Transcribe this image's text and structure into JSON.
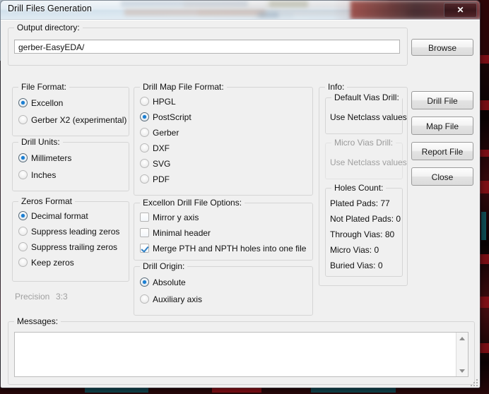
{
  "window": {
    "title": "Drill Files Generation",
    "close_label": "✕"
  },
  "output": {
    "legend": "Output directory:",
    "value": "gerber-EasyEDA/",
    "browse_label": "Browse"
  },
  "file_format": {
    "legend": "File Format:",
    "options": [
      {
        "label": "Excellon",
        "selected": true
      },
      {
        "label": "Gerber X2 (experimental)",
        "selected": false
      }
    ]
  },
  "drill_units": {
    "legend": "Drill Units:",
    "options": [
      {
        "label": "Millimeters",
        "selected": true
      },
      {
        "label": "Inches",
        "selected": false
      }
    ]
  },
  "zeros_format": {
    "legend": "Zeros Format",
    "options": [
      {
        "label": "Decimal format",
        "selected": true
      },
      {
        "label": "Suppress leading zeros",
        "selected": false
      },
      {
        "label": "Suppress trailing zeros",
        "selected": false
      },
      {
        "label": "Keep zeros",
        "selected": false
      }
    ],
    "precision_label": "Precision",
    "precision_value": "3:3"
  },
  "drill_map_format": {
    "legend": "Drill Map File Format:",
    "options": [
      {
        "label": "HPGL",
        "selected": false
      },
      {
        "label": "PostScript",
        "selected": true
      },
      {
        "label": "Gerber",
        "selected": false
      },
      {
        "label": "DXF",
        "selected": false
      },
      {
        "label": "SVG",
        "selected": false
      },
      {
        "label": "PDF",
        "selected": false
      }
    ]
  },
  "excellon_options": {
    "legend": "Excellon Drill File Options:",
    "options": [
      {
        "label": "Mirror y axis",
        "checked": false
      },
      {
        "label": "Minimal header",
        "checked": false
      },
      {
        "label": "Merge PTH and NPTH holes into one file",
        "checked": true
      }
    ]
  },
  "drill_origin": {
    "legend": "Drill Origin:",
    "options": [
      {
        "label": "Absolute",
        "selected": true
      },
      {
        "label": "Auxiliary axis",
        "selected": false
      }
    ]
  },
  "info": {
    "legend": "Info:",
    "default_vias": {
      "legend": "Default Vias Drill:",
      "value": "Use Netclass values"
    },
    "micro_vias": {
      "legend": "Micro Vias Drill:",
      "value": "Use Netclass values"
    },
    "holes_count": {
      "legend": "Holes Count:",
      "rows": [
        "Plated Pads: 77",
        "Not Plated Pads: 0",
        "Through Vias: 80",
        "Micro Vias: 0",
        "Buried Vias: 0"
      ]
    }
  },
  "actions": [
    {
      "label": "Drill File"
    },
    {
      "label": "Map File"
    },
    {
      "label": "Report File"
    },
    {
      "label": "Close"
    }
  ],
  "messages": {
    "legend": "Messages:",
    "value": ""
  },
  "colors": {
    "accent": "#1a7fd4",
    "dialog_bg": "#f0f0f0",
    "disabled_text": "#a0a0a0"
  }
}
